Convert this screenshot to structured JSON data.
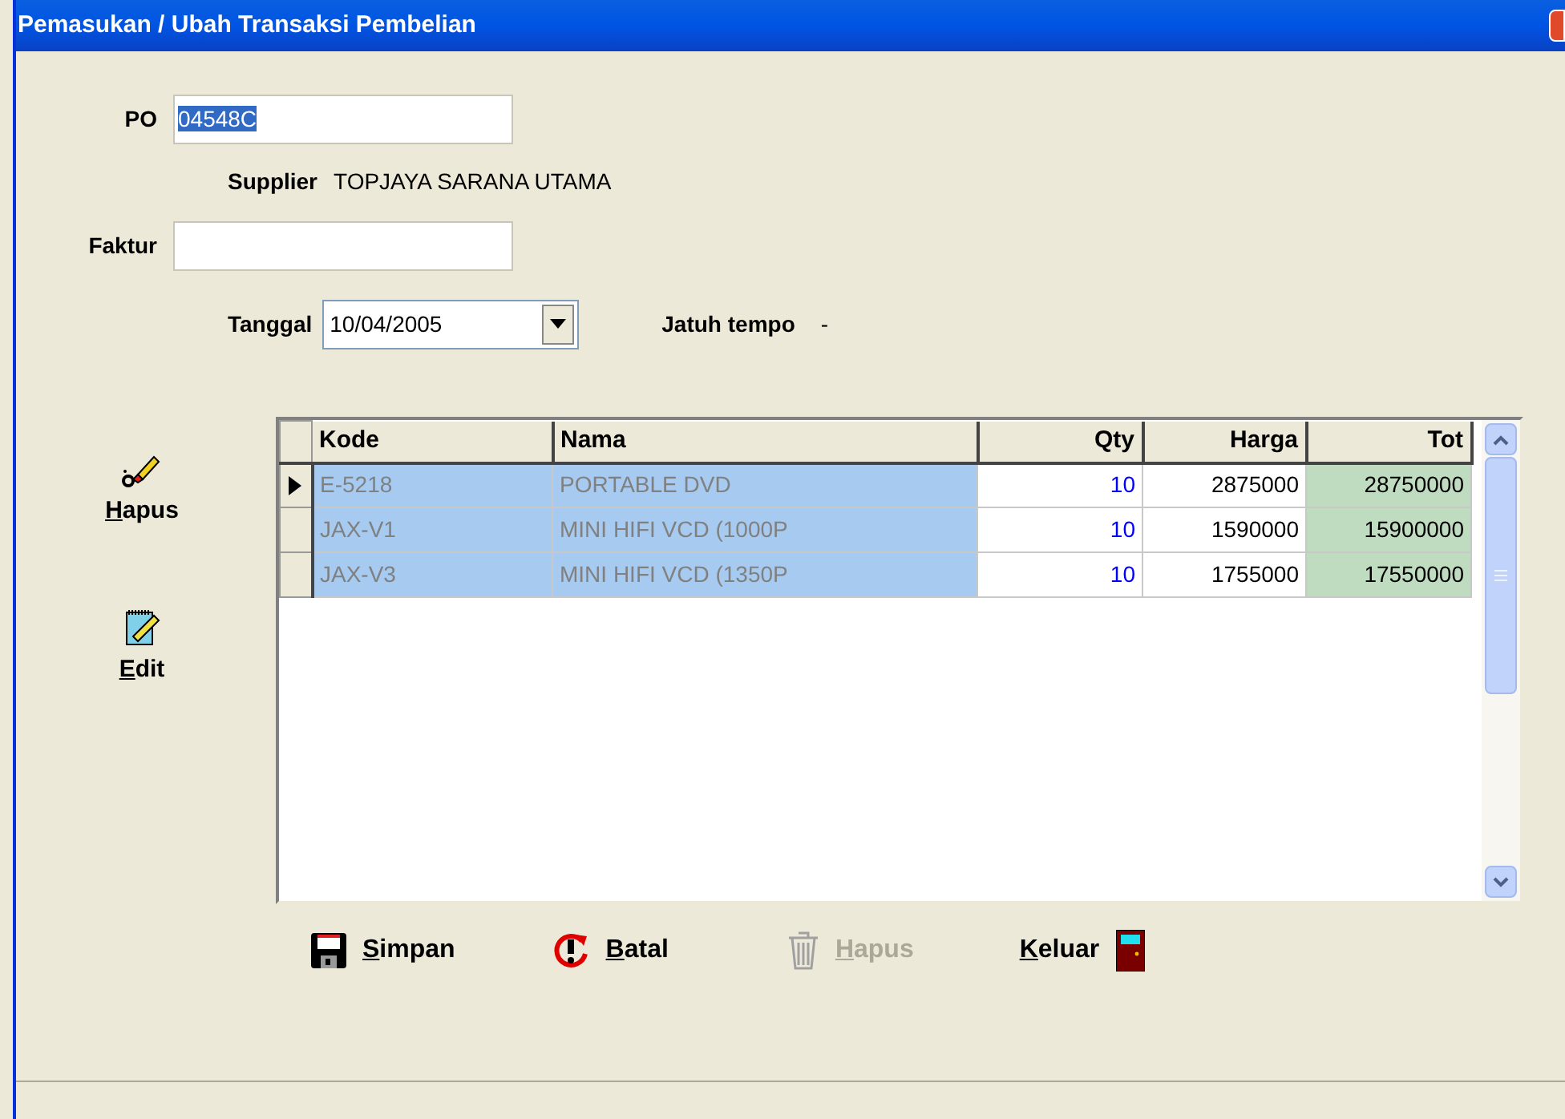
{
  "window": {
    "title": "Pemasukan / Ubah Transaksi Pembelian"
  },
  "form": {
    "po": {
      "label": "PO",
      "value": "04548C",
      "text_selected": true
    },
    "supplier": {
      "label": "Supplier",
      "value": "TOPJAYA SARANA UTAMA"
    },
    "faktur": {
      "label": "Faktur"
    },
    "tanggal": {
      "label": "Tanggal",
      "value": "10/04/2005"
    },
    "jatuh_tempo": {
      "label": "Jatuh tempo",
      "value": "-"
    }
  },
  "side_buttons": [
    {
      "kind": "delete",
      "label": "Hapus"
    },
    {
      "kind": "edit",
      "label": "Edit"
    }
  ],
  "table": {
    "columns": [
      "Kode",
      "Nama",
      "Qty",
      "Harga",
      "Tot"
    ],
    "rows": [
      {
        "current": true,
        "selected": true,
        "cells": [
          "E-5218",
          "PORTABLE DVD",
          "10",
          "2875000",
          "28750000"
        ]
      },
      {
        "current": false,
        "selected": true,
        "cells": [
          "JAX-V1",
          "MINI HIFI VCD (1000P",
          "10",
          "1590000",
          "15900000"
        ]
      },
      {
        "current": false,
        "selected": true,
        "cells": [
          "JAX-V3",
          "MINI HIFI VCD (1350P",
          "10",
          "1755000",
          "17550000"
        ]
      }
    ]
  },
  "buttons": [
    {
      "kind": "save",
      "label": "Simpan",
      "disabled": false
    },
    {
      "kind": "cancel",
      "label": "Batal",
      "disabled": false
    },
    {
      "kind": "delete",
      "label": "Hapus",
      "disabled": true
    },
    {
      "kind": "exit",
      "label": "Keluar",
      "disabled": false
    }
  ]
}
